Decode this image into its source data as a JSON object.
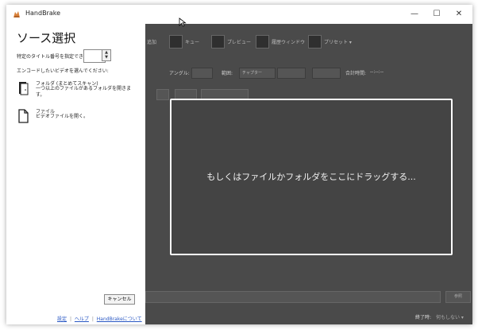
{
  "window": {
    "title": "HandBrake",
    "controls": {
      "minimize": "—",
      "maximize": "☐",
      "close": "✕"
    }
  },
  "source_panel": {
    "heading": "ソース選択",
    "title_number_label": "特定のタイトル番号を指定できます:",
    "title_number_value": "",
    "choose_prompt": "エンコードしたいビデオを選んでください:",
    "folder_option": {
      "name": "フォルダ (まとめてスキャン)",
      "description": "一つ以上のファイルがあるフォルダを開きます。"
    },
    "file_option": {
      "name": "ファイル",
      "description": "ビデオファイルを開く。"
    },
    "cancel_label": "キャンセル",
    "footer": {
      "settings": "設定",
      "help": "ヘルプ",
      "about": "HandBrakeについて"
    }
  },
  "background_app": {
    "toolbar": {
      "queue_add": "追加",
      "queue": "キュー",
      "preview": "プレビュー",
      "activity": "履歴ウィンドウ",
      "presets": "プリセット ▾"
    },
    "row_angle_label": "アングル:",
    "row_range_label": "範囲:",
    "row_range_value": "チャプター",
    "row_duration_label": "合計時間:",
    "row_duration_value": "--:--:--",
    "status_done_label": "終了時:",
    "status_done_value": "何もしない ▾",
    "browse_label": "参照"
  },
  "dropzone": {
    "text": "もしくはファイルかフォルダをここにドラッグする..."
  }
}
